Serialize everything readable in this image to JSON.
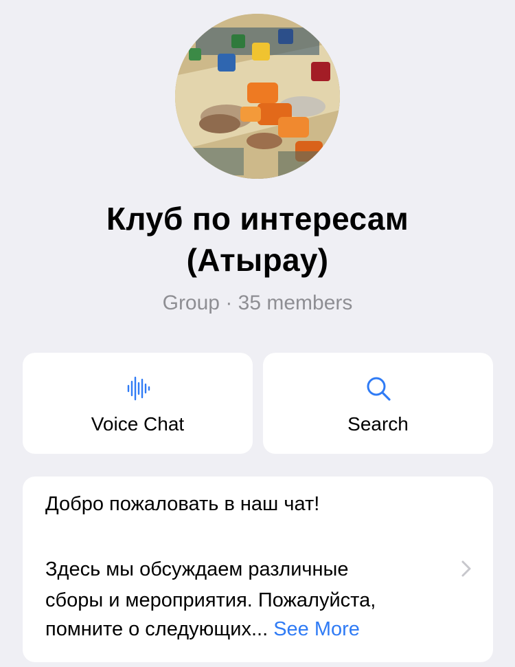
{
  "group": {
    "title_line1": "Клуб по интересам",
    "title_line2": "(Атырау)",
    "subtitle": "Group · 35 members"
  },
  "actions": {
    "voice_chat": {
      "label": "Voice Chat",
      "icon": "waveform-icon"
    },
    "search": {
      "label": "Search",
      "icon": "search-icon"
    }
  },
  "description": {
    "line1": "Добро пожаловать в наш чат!",
    "line2": "Здесь мы обсуждаем различные",
    "line3": "сборы и мероприятия. Пожалуйста,",
    "line4": "помните о следующих...",
    "see_more": "See More"
  },
  "colors": {
    "background": "#efeff4",
    "card": "#ffffff",
    "accent": "#2f7bf5",
    "secondary_text": "#8e8e93"
  }
}
